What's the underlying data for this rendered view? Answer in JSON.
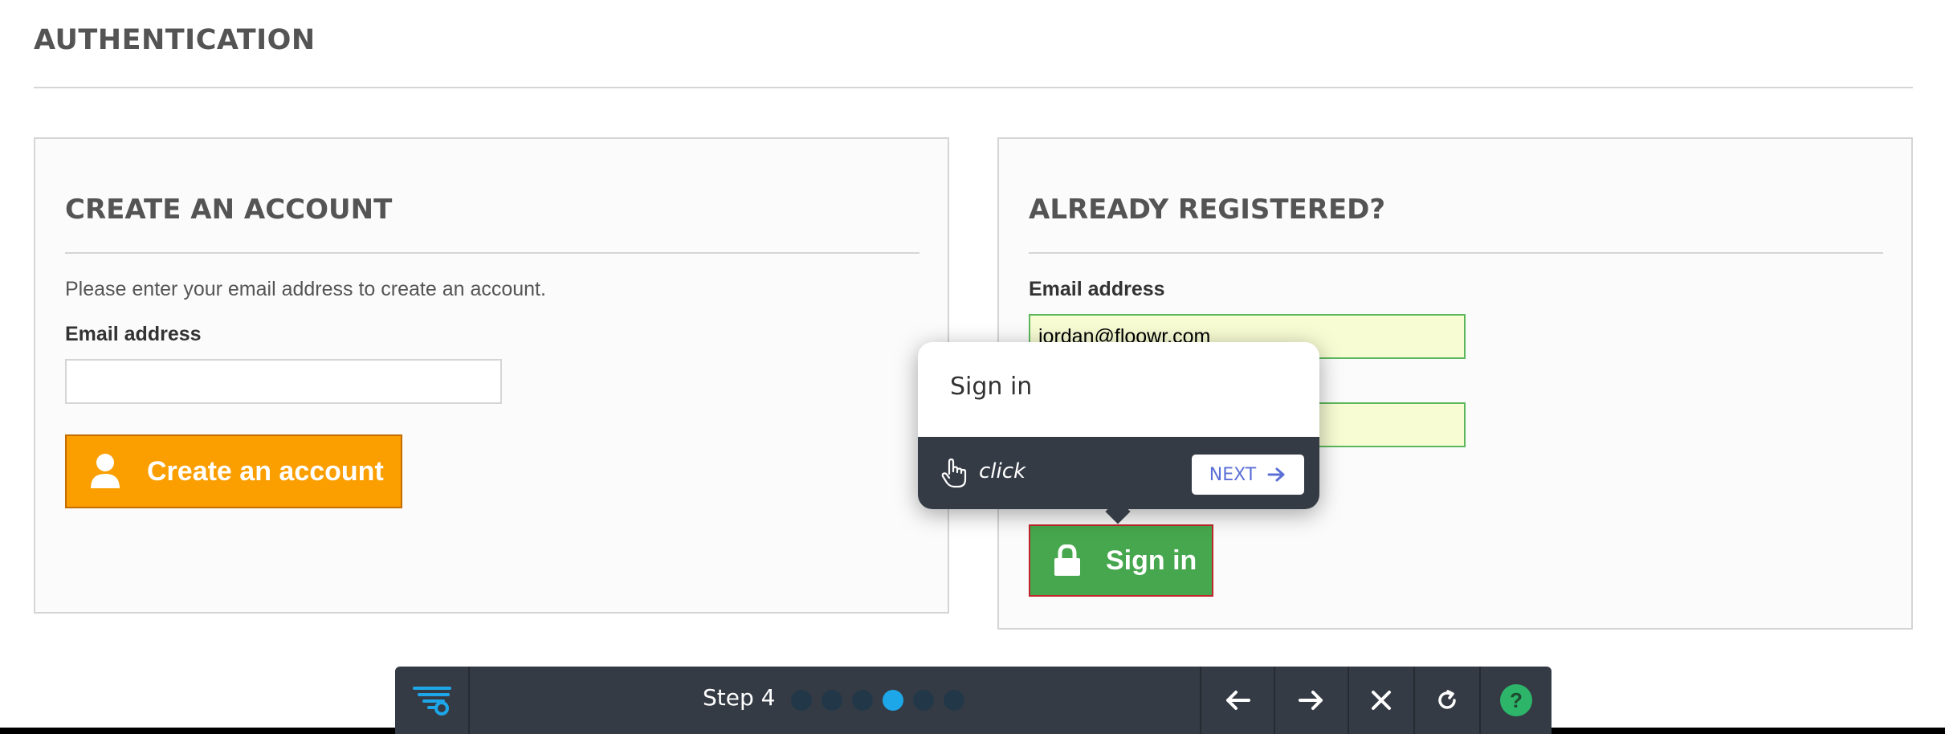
{
  "page": {
    "heading": "AUTHENTICATION"
  },
  "create_account": {
    "title": "CREATE AN ACCOUNT",
    "intro": "Please enter your email address to create an account.",
    "email_label": "Email address",
    "email_value": "",
    "button_label": "Create an account",
    "button_icon": "user-icon",
    "button_color": "#fb9e00"
  },
  "login": {
    "title": "ALREADY REGISTERED?",
    "email_label": "Email address",
    "email_value": "jordan@floowr.com",
    "password_value": "",
    "button_label": "Sign in",
    "button_icon": "lock-icon",
    "button_color": "#46a74e"
  },
  "tooltip": {
    "title": "Sign in",
    "action": "click",
    "next_label": "NEXT"
  },
  "toolbar": {
    "step_label": "Step 4",
    "total_steps": 6,
    "current_step": 4,
    "help_label": "?",
    "accent_color": "#1ea7e8"
  }
}
